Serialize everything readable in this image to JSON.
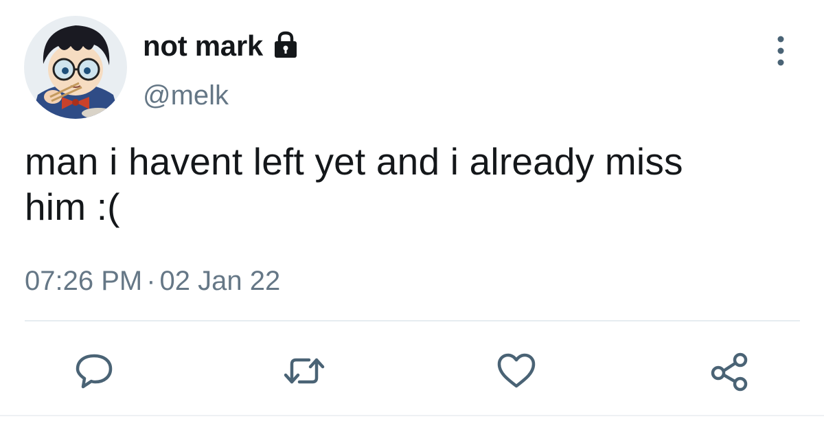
{
  "tweet": {
    "display_name": "not mark",
    "handle": "@melk",
    "text_line1": "man i havent left yet and i already miss",
    "text_line2": "him :(",
    "time": "07:26 PM",
    "separator": "·",
    "date": "02 Jan 22"
  },
  "icons": {
    "lock": "lock-icon",
    "more": "vertical-ellipsis-icon",
    "reply": "speech-bubble-icon",
    "retweet": "retweet-arrows-icon",
    "like": "heart-icon",
    "share": "share-nodes-icon"
  },
  "colors": {
    "text": "#14171a",
    "secondary": "#657786",
    "icon": "#4a6375",
    "divider": "#e6ecf0"
  }
}
